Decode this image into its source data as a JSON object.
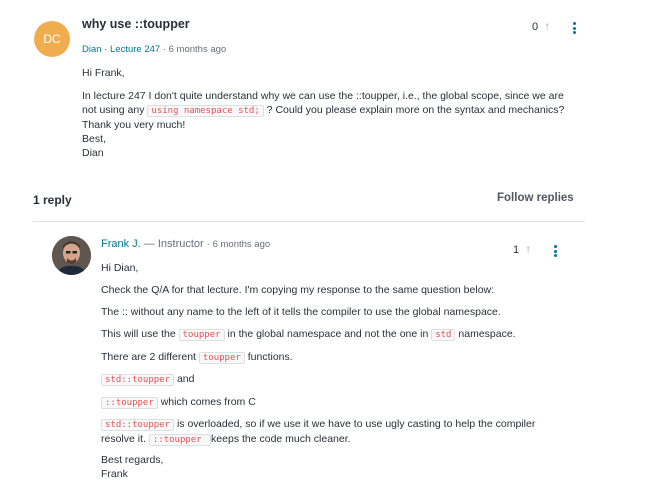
{
  "question": {
    "avatar_initials": "DC",
    "title": "why use ::toupper",
    "author": "Dian",
    "separator": " · ",
    "lecture": "Lecture 247",
    "time": " · 6 months ago",
    "votes": "0",
    "greeting": "Hi Frank,",
    "body_p1_a": "In lecture 247 I don't quite understand why we can use the ::toupper, i.e., the global scope, since we are",
    "body_p1_b": "not using any ",
    "body_code": "using namespace std;",
    "body_p1_c": " ? Could you please explain more on the syntax and mechanics?",
    "thanks": "Thank you very much!",
    "closing": "Best,",
    "signature": "Dian"
  },
  "replies_header": {
    "count": "1 reply",
    "follow": "Follow replies"
  },
  "reply": {
    "author": "Frank J.",
    "role": " — Instructor",
    "time": "· 6 months ago",
    "votes": "1",
    "greeting": "Hi Dian,",
    "p1": "Check the Q/A for that lecture. I'm copying my response to the same question below:",
    "p2": "The :: without any name to the left of it tells the compiler to use the global namespace.",
    "p3_a": "This will use the ",
    "p3_code1": "toupper",
    "p3_b": " in the global namespace and not the one in ",
    "p3_code2": "std",
    "p3_c": " namespace.",
    "p4_a": "There are 2 different ",
    "p4_code": "toupper",
    "p4_b": " functions.",
    "p5_code": "std::toupper",
    "p5_b": " and",
    "p6_code": "::toupper",
    "p6_b": " which comes from C",
    "p7_code": "std::toupper",
    "p7_b": " is overloaded, so if we use it we have to use ugly casting to help the compiler",
    "p7_c": "resolve it. ",
    "p7_code2": "::toupper ",
    "p7_d": " keeps the code much cleaner.",
    "closing": "Best regards,",
    "signature": "Frank"
  }
}
